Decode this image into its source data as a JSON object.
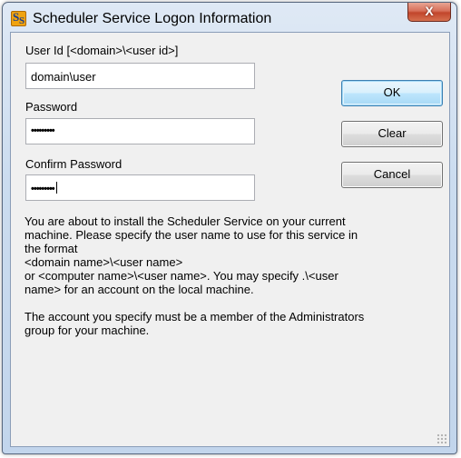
{
  "window": {
    "title": "Scheduler Service Logon Information",
    "app_icon_letters": "SS",
    "close_glyph": "X"
  },
  "form": {
    "user_id_label": "User Id   [<domain>\\<user id>]",
    "user_id_value": "domain\\user",
    "password_label": "Password",
    "password_value": "•••••••••",
    "confirm_label": "Confirm Password",
    "confirm_value": "•••••••••"
  },
  "buttons": {
    "ok": "OK",
    "clear": "Clear",
    "cancel": "Cancel"
  },
  "info": {
    "paragraph1_lines": [
      "You are about to install the Scheduler Service on your current",
      "machine. Please specify the user name to use for this service in",
      "the format",
      "<domain name>\\<user name>",
      "or <computer name>\\<user name>. You may specify .\\<user",
      "name> for an account on the local machine."
    ],
    "paragraph2_lines": [
      "The account you specify must be a member of the Administrators",
      "group for your machine."
    ]
  },
  "colors": {
    "frame": "#c2d5ec",
    "client": "#f0f0f0",
    "close_button": "#c2452b",
    "default_button_border": "#3c7fb1"
  },
  "icons": [
    "app-logo-icon",
    "close-icon",
    "resize-grip-icon"
  ]
}
